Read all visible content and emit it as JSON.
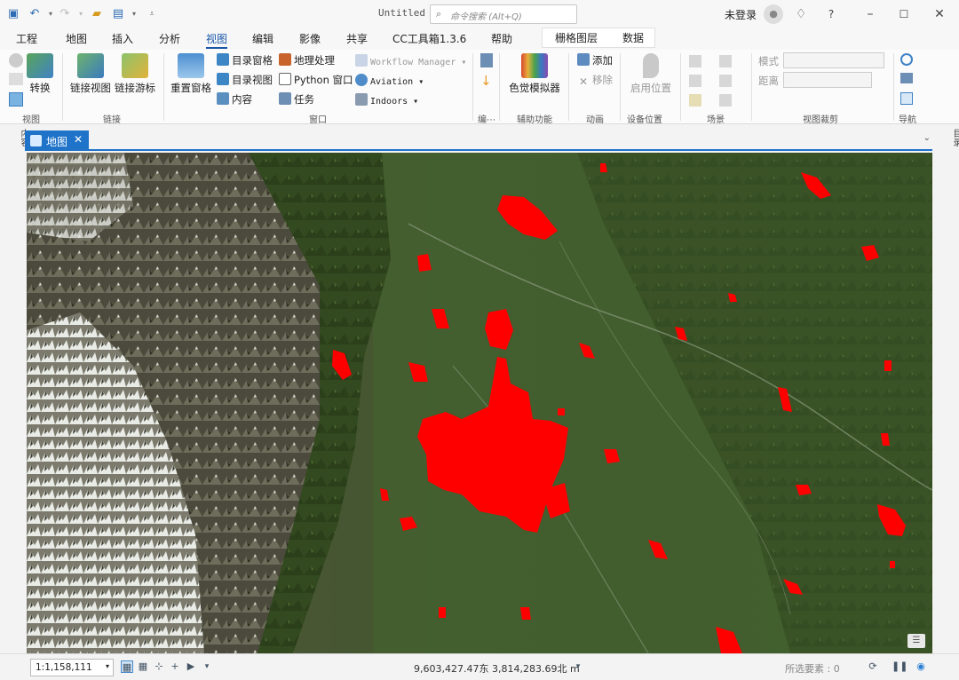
{
  "window": {
    "title": "Untitled",
    "search_placeholder": "命令搜索 (Alt+Q)",
    "login": "未登录"
  },
  "menus": [
    "工程",
    "地图",
    "插入",
    "分析",
    "视图",
    "编辑",
    "影像",
    "共享",
    "CC工具箱1.3.6",
    "帮助"
  ],
  "active_menu": "视图",
  "context_tabs": [
    "栅格图层",
    "数据"
  ],
  "ribbon": {
    "view_group": {
      "convert": "转换",
      "label": "视图"
    },
    "link_group": {
      "link_views": "链接视图",
      "link_cursor": "链接游标",
      "label": "链接"
    },
    "window_group": {
      "reset_panes": "重置窗格",
      "catalog_pane": "目录窗格",
      "catalog_view": "目录视图",
      "contents": "内容",
      "geoprocessing": "地理处理",
      "python_window": "Python 窗口",
      "tasks": "任务",
      "workflow_manager": "Workflow Manager",
      "aviation": "Aviation",
      "indoors": "Indoors",
      "label": "窗口"
    },
    "clip_group": {
      "label": "编⋯"
    },
    "accessibility_group": {
      "simulator": "色觉模拟器",
      "label": "辅助功能"
    },
    "animation_group": {
      "add": "添加",
      "remove": "移除",
      "label": "动画"
    },
    "device_group": {
      "enable_location": "启用位置",
      "label": "设备位置"
    },
    "scene_group": {
      "label": "场景"
    },
    "view_clip_group": {
      "mode_label": "模式",
      "distance_label": "距离",
      "label": "视图裁剪"
    },
    "nav_group": {
      "label": "导航"
    }
  },
  "side_panels": {
    "left": "内容",
    "right": "目录"
  },
  "map_tab": {
    "label": "地图"
  },
  "status": {
    "scale": "1:1,158,111",
    "coordinates": "9,603,427.47东 3,814,283.69北 m",
    "selected_features": "所选要素 : 0"
  }
}
